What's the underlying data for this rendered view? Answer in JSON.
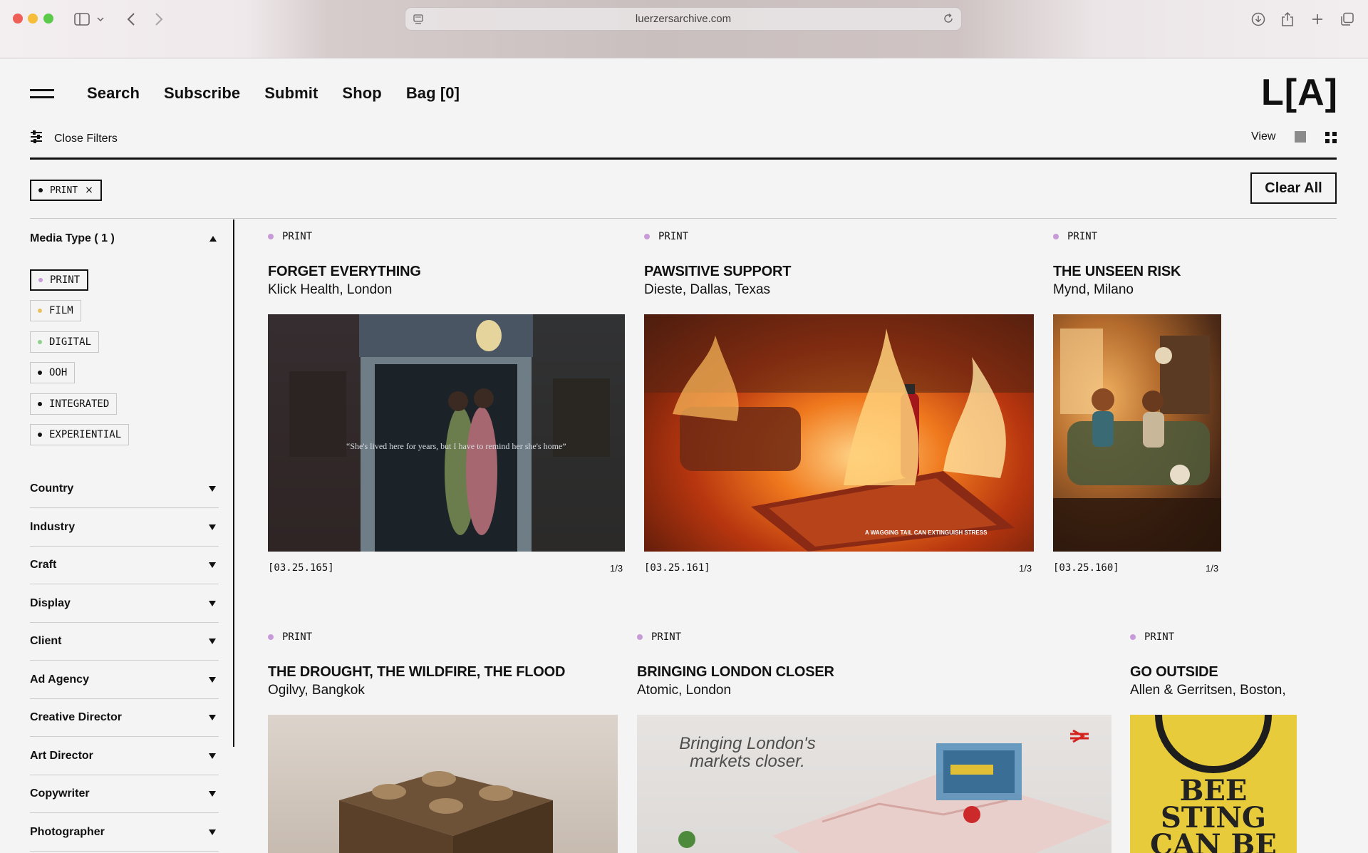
{
  "browser": {
    "url": "luerzersarchive.com"
  },
  "header": {
    "nav": [
      "Search",
      "Subscribe",
      "Submit",
      "Shop",
      "Bag [0]"
    ],
    "logo": "L[A]",
    "filter_toggle_label": "Close Filters",
    "view_label": "View"
  },
  "active_filters": {
    "chips": [
      {
        "label": "PRINT"
      }
    ],
    "clear_all_label": "Clear All"
  },
  "sidebar": {
    "media_type_label": "Media Type ( 1 )",
    "media_types": [
      {
        "label": "PRINT",
        "selected": true,
        "dot_color": "#c79bd7"
      },
      {
        "label": "FILM",
        "selected": false,
        "dot_color": "#e9c25f"
      },
      {
        "label": "DIGITAL",
        "selected": false,
        "dot_color": "#8fcf8a"
      },
      {
        "label": "OOH",
        "selected": false,
        "dot_color": "#111111"
      },
      {
        "label": "INTEGRATED",
        "selected": false,
        "dot_color": "#111111"
      },
      {
        "label": "EXPERIENTIAL",
        "selected": false,
        "dot_color": "#111111"
      }
    ],
    "filters": [
      "Country",
      "Industry",
      "Craft",
      "Display",
      "Client",
      "Ad Agency",
      "Creative Director",
      "Art Director",
      "Copywriter",
      "Photographer"
    ]
  },
  "cards": [
    {
      "tag": "PRINT",
      "title": "FORGET EVERYTHING",
      "subtitle": "Klick Health, London",
      "id": "[03.25.165]",
      "count": "1/3",
      "image_text": "“She's lived here for years, but I have to remind her she's home”"
    },
    {
      "tag": "PRINT",
      "title": "PAWSITIVE SUPPORT",
      "subtitle": "Dieste, Dallas, Texas",
      "id": "[03.25.161]",
      "count": "1/3",
      "image_text": "A WAGGING TAIL CAN EXTINGUISH STRESS"
    },
    {
      "tag": "PRINT",
      "title": "THE UNSEEN RISK",
      "subtitle": "Mynd, Milano",
      "id": "[03.25.160]",
      "count": "1/3",
      "image_text": ""
    },
    {
      "tag": "PRINT",
      "title": "THE DROUGHT, THE WILDFIRE, THE FLOOD",
      "subtitle": "Ogilvy, Bangkok",
      "id": "",
      "count": "",
      "image_text": ""
    },
    {
      "tag": "PRINT",
      "title": "BRINGING LONDON CLOSER",
      "subtitle": "Atomic, London",
      "id": "",
      "count": "",
      "image_text": "Bringing London's markets closer."
    },
    {
      "tag": "PRINT",
      "title": "GO OUTSIDE",
      "subtitle": "Allen & Gerritsen, Boston,",
      "id": "",
      "count": "",
      "image_text": "BEE STING CAN BE PAINFUL"
    }
  ],
  "colors": {
    "accent_print": "#c79bd7",
    "background": "#f4f4f4"
  }
}
